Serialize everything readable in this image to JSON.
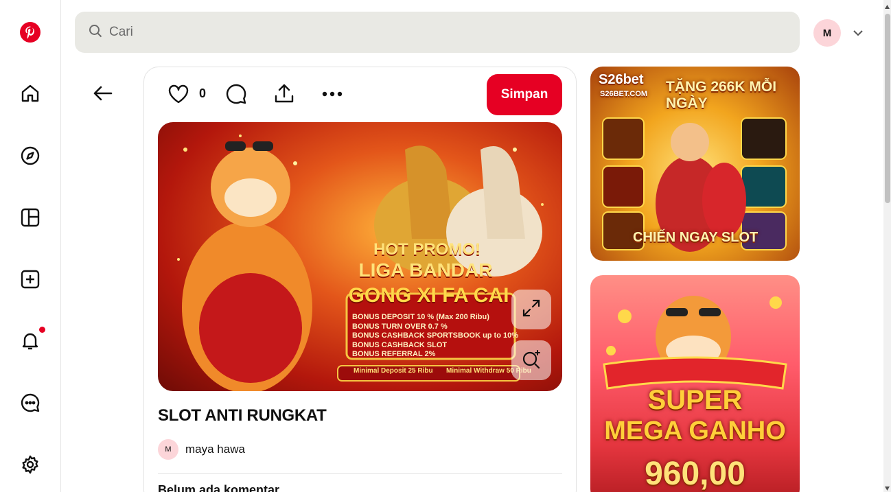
{
  "search": {
    "placeholder": "Cari"
  },
  "user": {
    "initial": "M"
  },
  "pin": {
    "like_count": "0",
    "save_label": "Simpan",
    "title": "SLOT ANTI RUNGKAT",
    "author_initial": "M",
    "author_name": "maya hawa",
    "comments_heading": "Belum ada komentar",
    "image_text": {
      "headline1": "HOT PROMO!",
      "headline2": "LIGA BANDAR",
      "headline3": "GONG XI FA CAI",
      "bullets": [
        "BONUS DEPOSIT 10 % (Max 200 Ribu)",
        "BONUS TURN OVER 0.7 %",
        "BONUS CASHBACK SPORTSBOOK up to 10%",
        "BONUS CASHBACK SLOT",
        "BONUS REFERRAL 2%"
      ],
      "footer1": "Minimal Deposit 25 Ribu",
      "footer2": "Minimal Withdraw 50 Ribu"
    }
  },
  "related": [
    {
      "brand": "S26bet",
      "domain": "S26BET.COM",
      "headline": "TẶNG 266K MỖI NGÀY",
      "footer": "CHIẾN NGAY SLOT"
    },
    {
      "line1": "SUPER",
      "line2": "MEGA GANHO",
      "amount": "960,00"
    }
  ],
  "colors": {
    "brand": "#e60023",
    "search_bg": "#e9e9e4",
    "avatar_bg": "#fcd5d9"
  },
  "icons": [
    "pinterest-logo",
    "home-icon",
    "compass-icon",
    "layout-icon",
    "plus-icon",
    "bell-icon",
    "chat-icon",
    "gear-icon",
    "search-icon",
    "chevron-down-icon",
    "arrow-left-icon",
    "heart-icon",
    "comment-icon",
    "share-icon",
    "more-icon",
    "expand-icon",
    "visual-search-icon"
  ]
}
